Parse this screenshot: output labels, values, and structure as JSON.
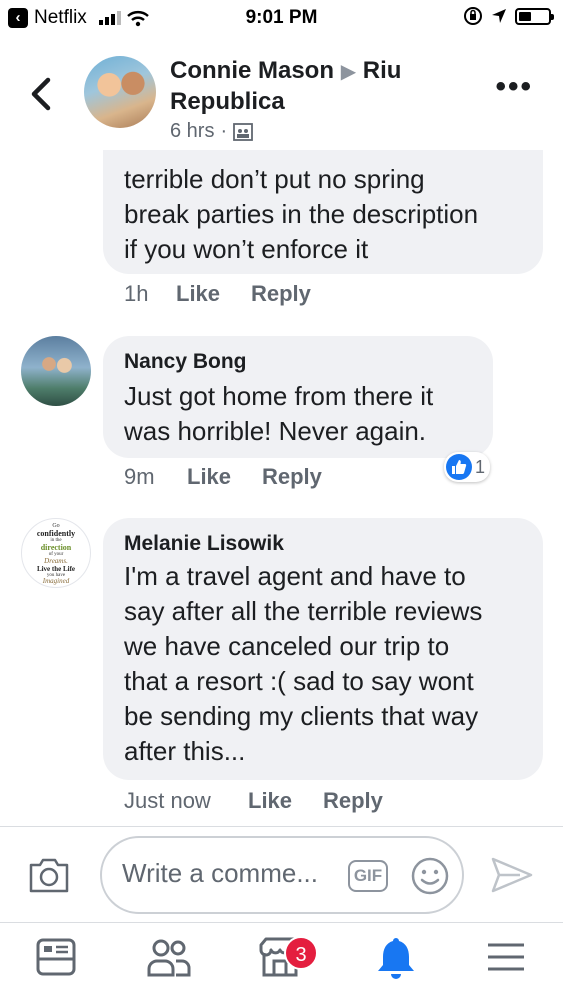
{
  "status_bar": {
    "back_app": "Netflix",
    "time": "9:01 PM"
  },
  "post_header": {
    "author": "Connie Mason",
    "target": "Riu Republica",
    "time": "6 hrs",
    "dot": "·"
  },
  "comments": [
    {
      "name": "",
      "text_lines": [
        "terrible don’t put no spring",
        "break parties in the description",
        "if you won’t enforce it"
      ],
      "time": "1h",
      "like": "Like",
      "reply": "Reply"
    },
    {
      "name": "Nancy Bong",
      "text_lines": [
        "Just got home from there it",
        "was horrible! Never again."
      ],
      "time": "9m",
      "like": "Like",
      "reply": "Reply",
      "reaction_count": "1"
    },
    {
      "name": "Melanie Lisowik",
      "text_lines": [
        "I'm a travel agent and have to",
        "say after all the terrible reviews",
        "we have canceled our trip to",
        "that a resort :( sad to say wont",
        "be sending my clients that way",
        "after this..."
      ],
      "time": "Just now",
      "like": "Like",
      "reply": "Reply",
      "avatar_text": [
        "Go",
        "confidently",
        "in the",
        "direction",
        "of your",
        "Dreams.",
        "Live the Life",
        "you have",
        "Imagined"
      ]
    }
  ],
  "composer": {
    "placeholder": "Write a comme...",
    "gif_label": "GIF"
  },
  "tab_bar": {
    "marketplace_badge": "3"
  },
  "colors": {
    "facebook_blue": "#1877f2",
    "badge_red": "#e41e3f",
    "bubble_bg": "#f0f1f4"
  }
}
